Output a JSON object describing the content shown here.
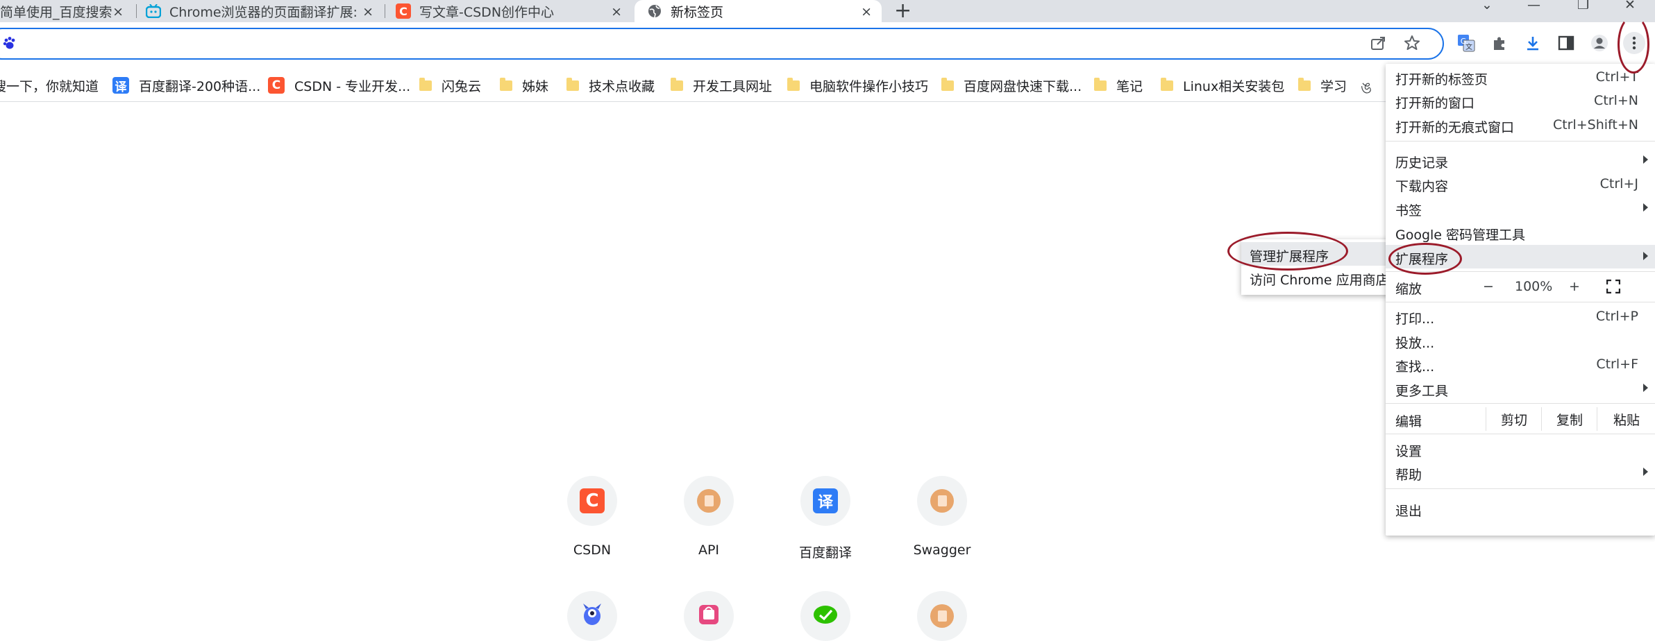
{
  "tabs": [
    {
      "title": "简单使用_百度搜索",
      "icon": "baidu-paw-icon"
    },
    {
      "title": "Chrome浏览器的页面翻译扩展:",
      "icon": "bilibili-tv-icon"
    },
    {
      "title": "写文章-CSDN创作中心",
      "icon": "csdn-c-icon"
    },
    {
      "title": "新标签页",
      "icon": "globe-icon"
    }
  ],
  "tab_close_glyph": "×",
  "new_tab_glyph": "+",
  "window_controls": {
    "dropdown": "⌄",
    "minimize": "—",
    "restore": "❐",
    "close": "✕"
  },
  "omnibox": {
    "value": "",
    "icon": "baidu-paw-icon"
  },
  "bookmarks": [
    {
      "label": "搜一下，你就知道",
      "icon": "none"
    },
    {
      "label": "百度翻译-200种语...",
      "icon": "translate-icon",
      "badge": "译",
      "color": "#2e7cf6"
    },
    {
      "label": "CSDN - 专业开发...",
      "icon": "csdn-c-icon",
      "badge": "C",
      "color": "#fc5531"
    },
    {
      "label": "闪兔云",
      "icon": "folder-icon"
    },
    {
      "label": "姊妹",
      "icon": "folder-icon"
    },
    {
      "label": "技术点收藏",
      "icon": "folder-icon"
    },
    {
      "label": "开发工具网址",
      "icon": "folder-icon"
    },
    {
      "label": "电脑软件操作小技巧",
      "icon": "folder-icon"
    },
    {
      "label": "百度网盘快速下载...",
      "icon": "folder-icon"
    },
    {
      "label": "笔记",
      "icon": "folder-icon"
    },
    {
      "label": "Linux相关安装包",
      "icon": "folder-icon"
    },
    {
      "label": "学习",
      "icon": "folder-icon"
    }
  ],
  "shortcuts": [
    {
      "label": "CSDN",
      "icon": "csdn-c-icon",
      "badge": "C",
      "color": "#fc5531"
    },
    {
      "label": "API",
      "icon": "page-icon"
    },
    {
      "label": "百度翻译",
      "icon": "translate-icon",
      "badge": "译",
      "color": "#2e7cf6"
    },
    {
      "label": "Swagger",
      "icon": "page-icon"
    },
    {
      "label": "",
      "icon": "monster-icon"
    },
    {
      "label": "",
      "icon": "bag-icon"
    },
    {
      "label": "",
      "icon": "wechat-icon"
    },
    {
      "label": "",
      "icon": "page-icon"
    }
  ],
  "menu": {
    "new_tab": {
      "label": "打开新的标签页",
      "shortcut": "Ctrl+T"
    },
    "new_window": {
      "label": "打开新的窗口",
      "shortcut": "Ctrl+N"
    },
    "new_incognito": {
      "label": "打开新的无痕式窗口",
      "shortcut": "Ctrl+Shift+N"
    },
    "history": {
      "label": "历史记录"
    },
    "downloads": {
      "label": "下载内容",
      "shortcut": "Ctrl+J"
    },
    "bookmarks": {
      "label": "书签"
    },
    "passwords": {
      "label": "Google 密码管理工具"
    },
    "extensions": {
      "label": "扩展程序"
    },
    "zoom": {
      "label": "缩放",
      "minus": "−",
      "value": "100%",
      "plus": "+"
    },
    "print": {
      "label": "打印...",
      "shortcut": "Ctrl+P"
    },
    "cast": {
      "label": "投放..."
    },
    "find": {
      "label": "查找...",
      "shortcut": "Ctrl+F"
    },
    "more_tools": {
      "label": "更多工具"
    },
    "edit": {
      "label": "编辑",
      "cut": "剪切",
      "copy": "复制",
      "paste": "粘贴"
    },
    "settings": {
      "label": "设置"
    },
    "help": {
      "label": "帮助"
    },
    "exit": {
      "label": "退出"
    }
  },
  "submenu": {
    "manage_extensions": "管理扩展程序",
    "visit_store": "访问 Chrome 应用商店"
  },
  "colors": {
    "accent": "#1a73e8",
    "annotation": "#9b1b2a",
    "menu_highlight": "#e8eaed"
  }
}
